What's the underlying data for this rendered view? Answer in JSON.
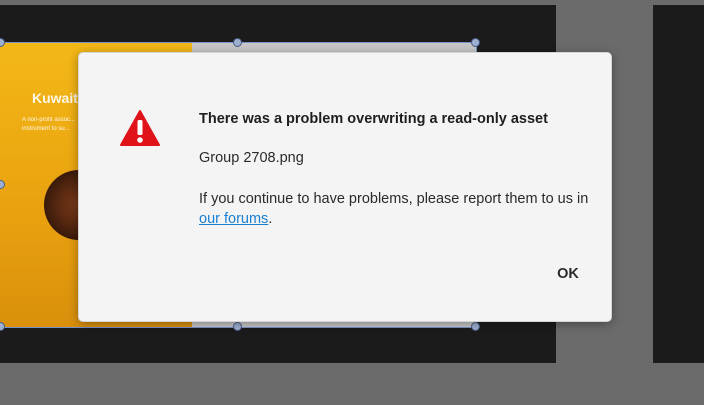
{
  "background_design": {
    "title": "Kuwaiti",
    "text": "A non-profit assoc... instrument to su..."
  },
  "dialog": {
    "title": "There was a problem overwriting a read-only asset",
    "filename": "Group 2708.png",
    "message_before_link": "If you continue to have problems, please report them to us in ",
    "link_text": "our forums",
    "message_after_link": ".",
    "ok_label": "OK",
    "icon": "warning-triangle-icon",
    "accent_color": "#e0121a",
    "link_color": "#1a7fd0"
  }
}
